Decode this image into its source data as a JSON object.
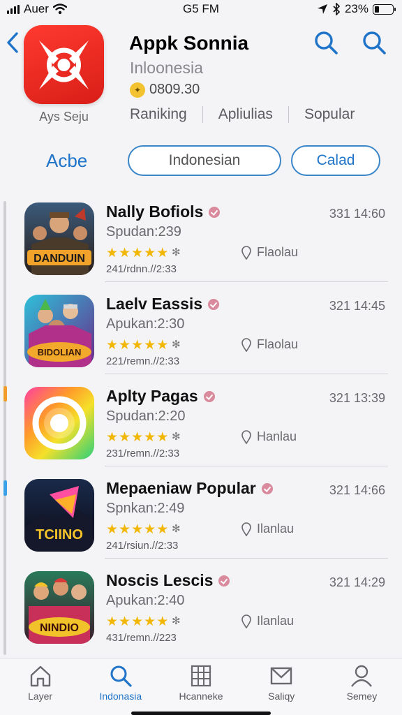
{
  "status_bar": {
    "carrier": "Auer",
    "time": "G5 FM",
    "battery": "23%",
    "battery_level": 0.23
  },
  "header": {
    "app_title": "Appk Sonnia",
    "app_subtitle": "Inloonesia",
    "rating_value": "0809.30",
    "icon_caption": "Ays Seju",
    "tabs": [
      "Raniking",
      "Apliulias",
      "Sopular"
    ]
  },
  "filter": {
    "label": "Acbe",
    "pill_primary": "Indonesian",
    "pill_secondary": "Calad"
  },
  "colors": {
    "accent": "#1f73c8",
    "star": "#f2b705",
    "brand_red": "#e8231b"
  },
  "list": [
    {
      "title": "Nally Bofiols",
      "time": "331 14:60",
      "subtitle": "Spudan:239",
      "location": "Flaolau",
      "meta": "241/rdnn.//2:33",
      "stars": 5,
      "icon": "game-icon-fighters"
    },
    {
      "title": "Laelv Eassis",
      "time": "321 14:45",
      "subtitle": "Apukan:2:30",
      "location": "Flaolau",
      "meta": "221/remn.//2:33",
      "stars": 5,
      "icon": "game-icon-heroes"
    },
    {
      "title": "Aplty Pagas",
      "time": "321 13:39",
      "subtitle": "Spudan:2:20",
      "location": "Hanlau",
      "meta": "231/remn.//2:33",
      "stars": 5,
      "icon": "rainbow-ring-icon"
    },
    {
      "title": "Mepaeniaw Popular",
      "time": "321 14:66",
      "subtitle": "Spnkan:2:49",
      "location": "Ilanlau",
      "meta": "241/rsiun.//2:33",
      "stars": 5,
      "icon": "tcuno-icon"
    },
    {
      "title": "Noscis Lescis",
      "time": "321 14:29",
      "subtitle": "Apukan:2:40",
      "location": "Ilanlau",
      "meta": "431/remn.//223",
      "stars": 5,
      "icon": "game-icon-party"
    }
  ],
  "thumb_text": {
    "t1": "DANDUIN",
    "t2": "BIDOLIAN",
    "t4": "TCIINO",
    "t5": "NINDIO"
  },
  "tabbar": [
    {
      "label": "Layer",
      "icon": "home-icon"
    },
    {
      "label": "Indonasia",
      "icon": "search-icon",
      "active": true
    },
    {
      "label": "Hcanneke",
      "icon": "grid-icon"
    },
    {
      "label": "Saliqy",
      "icon": "mail-icon"
    },
    {
      "label": "Semey",
      "icon": "person-icon"
    }
  ]
}
